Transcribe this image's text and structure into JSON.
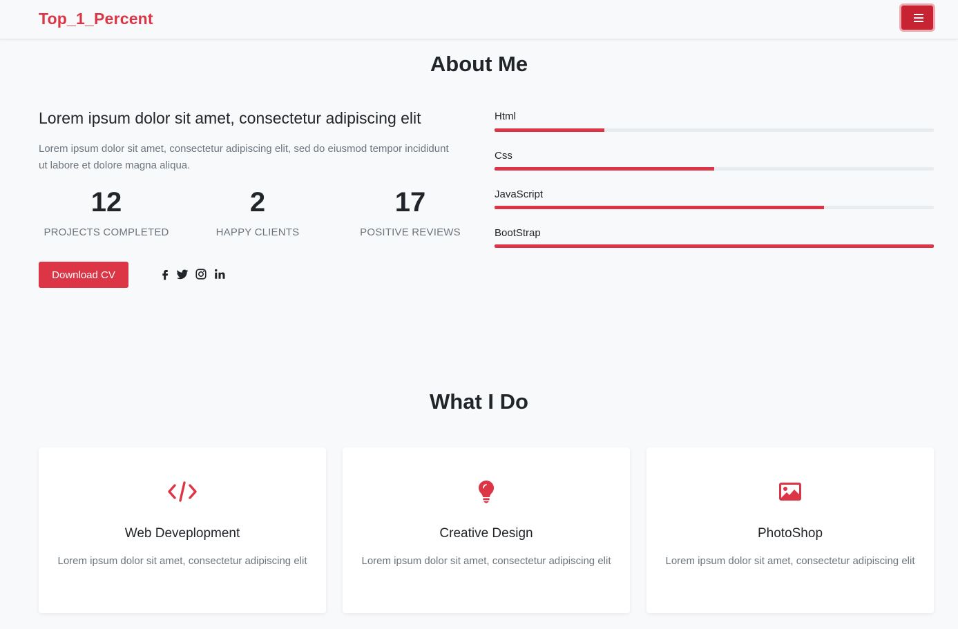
{
  "navbar": {
    "brand": "Top_1_Percent",
    "menu_icon": "hamburger-menu-icon"
  },
  "about": {
    "title": "About Me",
    "heading": "Lorem ipsum dolor sit amet, consectetur adipiscing elit",
    "text": "Lorem ipsum dolor sit amet, consectetur adipiscing elit, sed do eiusmod tempor incididunt ut labore et dolore magna aliqua.",
    "stats": [
      {
        "number": "12",
        "label": "PROJECTS COMPLETED"
      },
      {
        "number": "2",
        "label": "HAPPY CLIENTS"
      },
      {
        "number": "17",
        "label": "POSITIVE REVIEWS"
      }
    ],
    "download_label": "Download CV",
    "social_icons": [
      "facebook-icon",
      "twitter-icon",
      "instagram-icon",
      "linkedin-icon"
    ],
    "skills": [
      {
        "name": "Html",
        "percent": 25
      },
      {
        "name": "Css",
        "percent": 50
      },
      {
        "name": "JavaScript",
        "percent": 75
      },
      {
        "name": "BootStrap",
        "percent": 100
      }
    ]
  },
  "services": {
    "title": "What I Do",
    "items": [
      {
        "icon": "code-icon",
        "title": "Web Deveplopment",
        "desc": "Lorem ipsum dolor sit amet, consectetur adipiscing elit"
      },
      {
        "icon": "lightbulb-icon",
        "title": "Creative Design",
        "desc": "Lorem ipsum dolor sit amet, consectetur adipiscing elit"
      },
      {
        "icon": "image-icon",
        "title": "PhotoShop",
        "desc": "Lorem ipsum dolor sit amet, consectetur adipiscing elit"
      }
    ]
  },
  "colors": {
    "accent": "#dc3545",
    "muted": "#6c757d",
    "background": "#f8f9fa"
  }
}
